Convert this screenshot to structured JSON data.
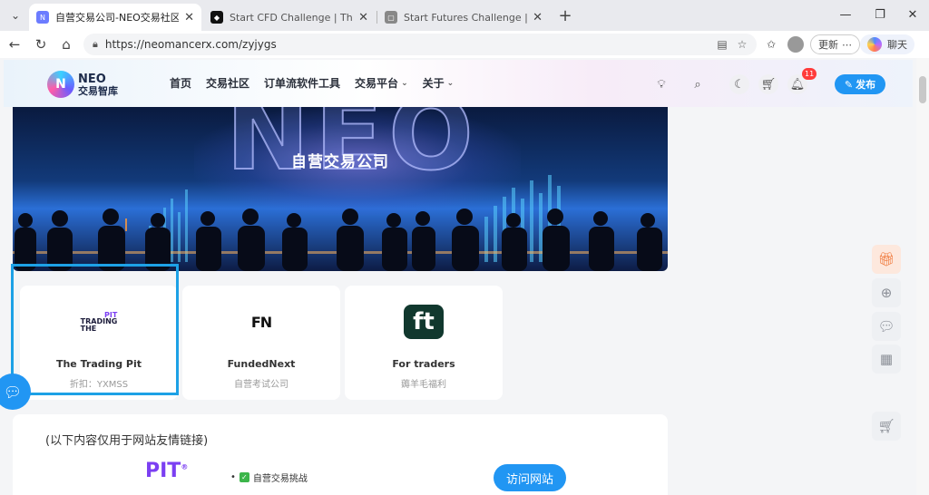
{
  "browser": {
    "tabs": [
      {
        "title": "自营交易公司-NEO交易社区",
        "active": true
      },
      {
        "title": "Start CFD Challenge | TheTradingPit",
        "active": false
      },
      {
        "title": "Start Futures Challenge | TheTradingPit",
        "active": false
      }
    ],
    "url": "https://neomancerx.com/zyjygs",
    "update_label": "更新",
    "copilot_label": "聊天"
  },
  "site": {
    "logo_line1": "NEO",
    "logo_line2": "交易智库",
    "nav": [
      {
        "label": "首页",
        "has_menu": false
      },
      {
        "label": "交易社区",
        "has_menu": false
      },
      {
        "label": "订单流软件工具",
        "has_menu": false
      },
      {
        "label": "交易平台",
        "has_menu": true
      },
      {
        "label": "关于",
        "has_menu": true
      }
    ],
    "notification_count": "11",
    "publish_label": "发布"
  },
  "hero": {
    "title": "自营交易公司",
    "big_text": "NEO"
  },
  "cards": [
    {
      "name": "The Trading Pit",
      "sub": "折扣：YXMSS",
      "logo_top": "PIT",
      "logo_mid": "TRADING",
      "logo_bot": "THE"
    },
    {
      "name": "FundedNext",
      "sub": "自营考试公司",
      "logo_text": "FN"
    },
    {
      "name": "For traders",
      "sub": "薅羊毛福利",
      "logo_text": "ft"
    }
  ],
  "panel": {
    "note": "(以下内容仅用于网站友情链接)",
    "brand": "PIT",
    "brand_mark": "®",
    "bullet": "自营交易挑战",
    "visit_label": "访问网站"
  },
  "colors": {
    "accent": "#2196f3",
    "highlight": "#1da1e6",
    "pit_purple": "#7b3ff2",
    "badge": "#ff3b3b"
  }
}
